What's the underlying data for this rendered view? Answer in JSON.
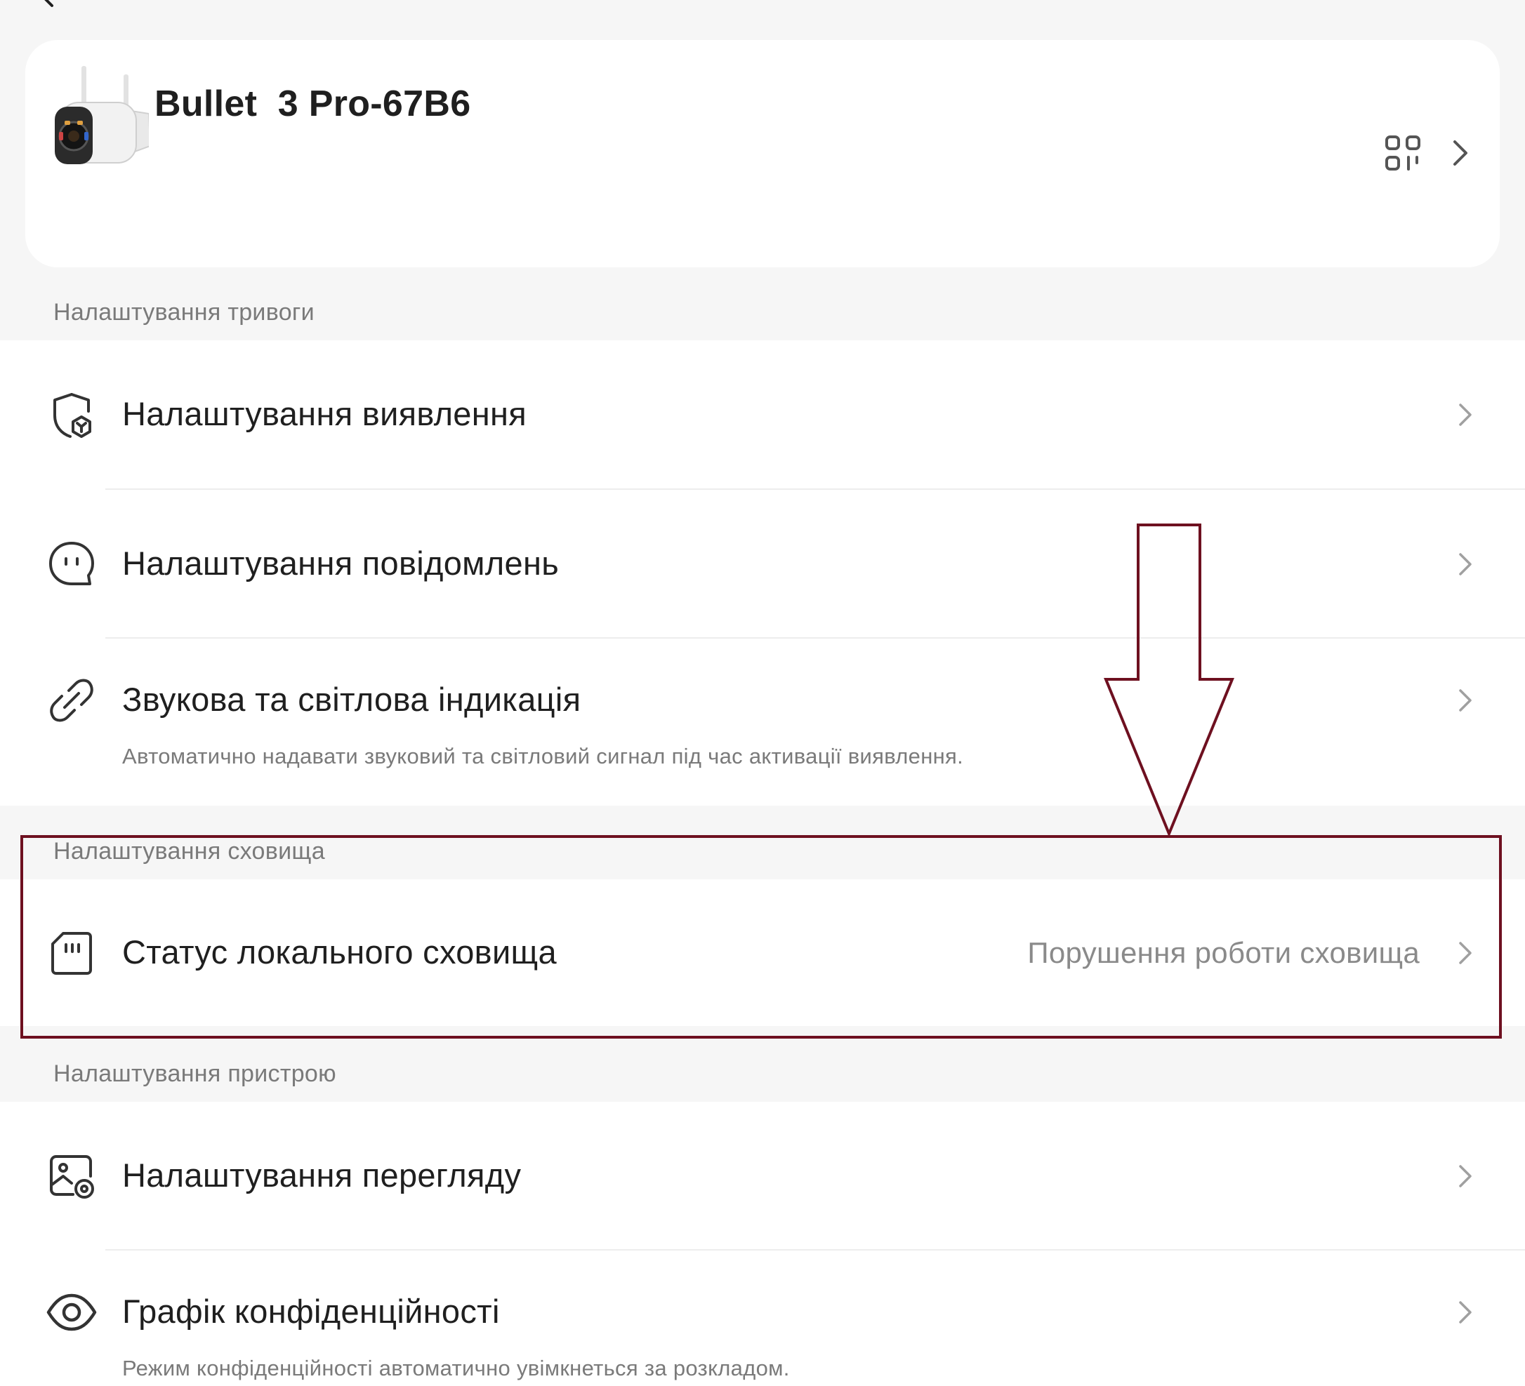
{
  "device": {
    "name": "Bullet  3 Pro-67B6"
  },
  "sections": {
    "alarm": {
      "header": "Налаштування тривоги"
    },
    "storage": {
      "header": "Налаштування сховища"
    },
    "device": {
      "header": "Налаштування пристрою"
    }
  },
  "rows": {
    "detection": {
      "label": "Налаштування виявлення"
    },
    "notifications": {
      "label": "Налаштування повідомлень"
    },
    "sound_light": {
      "label": "Звукова та світлова індикація",
      "subtitle": "Автоматично надавати звуковий та світловий сигнал під час активації виявлення."
    },
    "local_storage": {
      "label": "Статус локального сховища",
      "value": "Порушення роботи сховища"
    },
    "view_settings": {
      "label": "Налаштування перегляду"
    },
    "privacy_schedule": {
      "label": "Графік конфіденційності",
      "subtitle": "Режим конфіденційності автоматично увімкнеться за розкладом."
    }
  },
  "icons": {
    "back": "back-arrow-icon",
    "qr": "qr-code-icon",
    "detection": "shield-detection-icon",
    "notifications": "chat-bubble-icon",
    "sound_light": "link-icon",
    "local_storage": "sd-card-icon",
    "view_settings": "image-settings-icon",
    "privacy_schedule": "eye-icon",
    "chevron": "chevron-right-icon"
  },
  "colors": {
    "background": "#f6f6f6",
    "card": "#ffffff",
    "annotation": "#6e1020",
    "secondary_text": "#7a7a7a"
  }
}
